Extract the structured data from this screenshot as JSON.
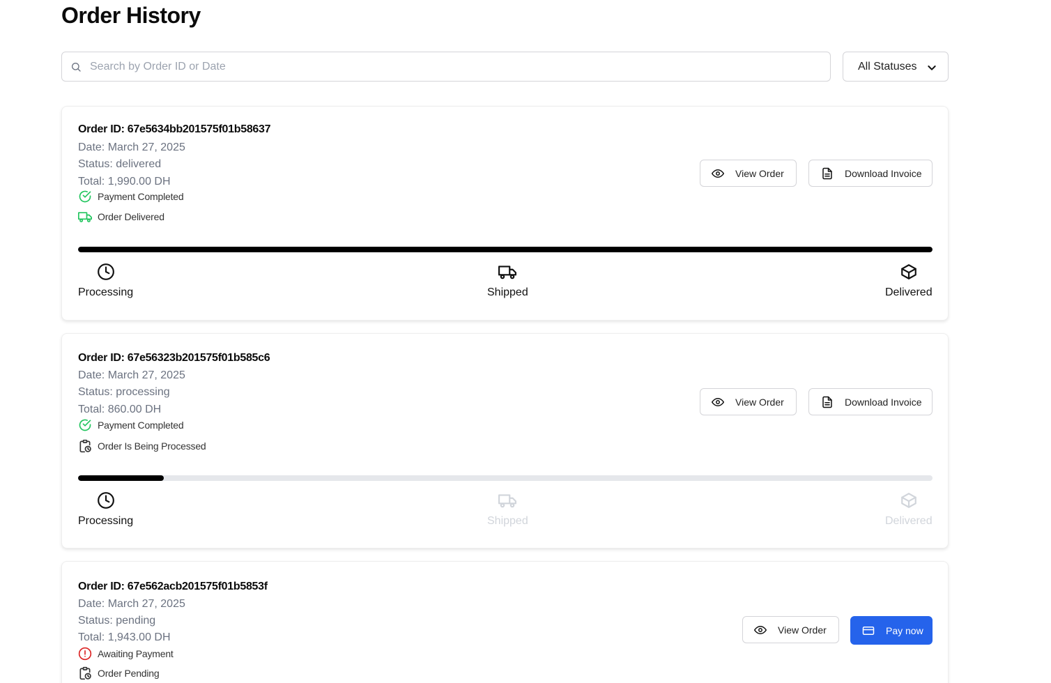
{
  "page_title": "Order History",
  "search": {
    "placeholder": "Search by Order ID or Date",
    "value": ""
  },
  "filter": {
    "selected": "All Statuses"
  },
  "buttons": {
    "view_order": "View Order",
    "download_invoice": "Download Invoice",
    "pay_now": "Pay now"
  },
  "progress_steps": [
    "Processing",
    "Shipped",
    "Delivered"
  ],
  "colors": {
    "accent": "#2563eb",
    "success": "#22c55e",
    "danger": "#dc2626",
    "progress": "#000000",
    "track": "#e5e7eb"
  },
  "orders": [
    {
      "id": "Order ID: 67e5634bb201575f01b58637",
      "date": "Date: March 27, 2025",
      "status": "Status: delivered",
      "total": "Total: 1,990.00 DH",
      "payment_flag": {
        "text": "Payment Completed",
        "icon": "check-circle-icon"
      },
      "order_flag": {
        "text": "Order Delivered",
        "icon": "truck-icon"
      },
      "progress": 1.0,
      "steps_done": 3
    },
    {
      "id": "Order ID: 67e56323b201575f01b585c6",
      "date": "Date: March 27, 2025",
      "status": "Status: processing",
      "total": "Total: 860.00 DH",
      "payment_flag": {
        "text": "Payment Completed",
        "icon": "check-circle-icon"
      },
      "order_flag": {
        "text": "Order Is Being Processed",
        "icon": "clipboard-clock-icon"
      },
      "progress": 0.1,
      "steps_done": 1
    },
    {
      "id": "Order ID: 67e562acb201575f01b5853f",
      "date": "Date: March 27, 2025",
      "status": "Status: pending",
      "total": "Total: 1,943.00 DH",
      "payment_flag": {
        "text": "Awaiting Payment",
        "icon": "alert-circle-icon"
      },
      "order_flag": {
        "text": "Order Pending",
        "icon": "clipboard-clock-icon"
      }
    }
  ]
}
